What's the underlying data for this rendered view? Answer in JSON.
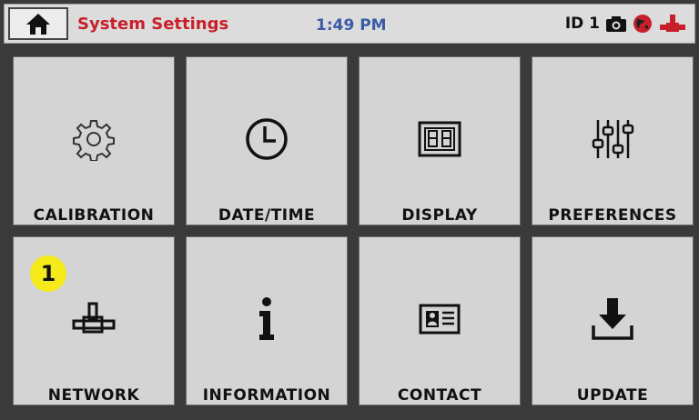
{
  "header": {
    "title": "System Settings",
    "time": "1:49 PM",
    "id_label": "ID 1"
  },
  "tiles": [
    {
      "label": "CALIBRATION",
      "icon": "gear-icon"
    },
    {
      "label": "DATE/TIME",
      "icon": "clock-icon"
    },
    {
      "label": "DISPLAY",
      "icon": "display-icon"
    },
    {
      "label": "PREFERENCES",
      "icon": "sliders-icon"
    },
    {
      "label": "NETWORK",
      "icon": "network-icon"
    },
    {
      "label": "INFORMATION",
      "icon": "info-icon"
    },
    {
      "label": "CONTACT",
      "icon": "contact-card-icon"
    },
    {
      "label": "UPDATE",
      "icon": "download-icon"
    }
  ],
  "callout": "1",
  "colors": {
    "title": "#c8202a",
    "time": "#3b5aa8",
    "badge": "#f5ea1a",
    "tile_bg": "#d4d4d4",
    "frame": "#3a3a3a"
  }
}
